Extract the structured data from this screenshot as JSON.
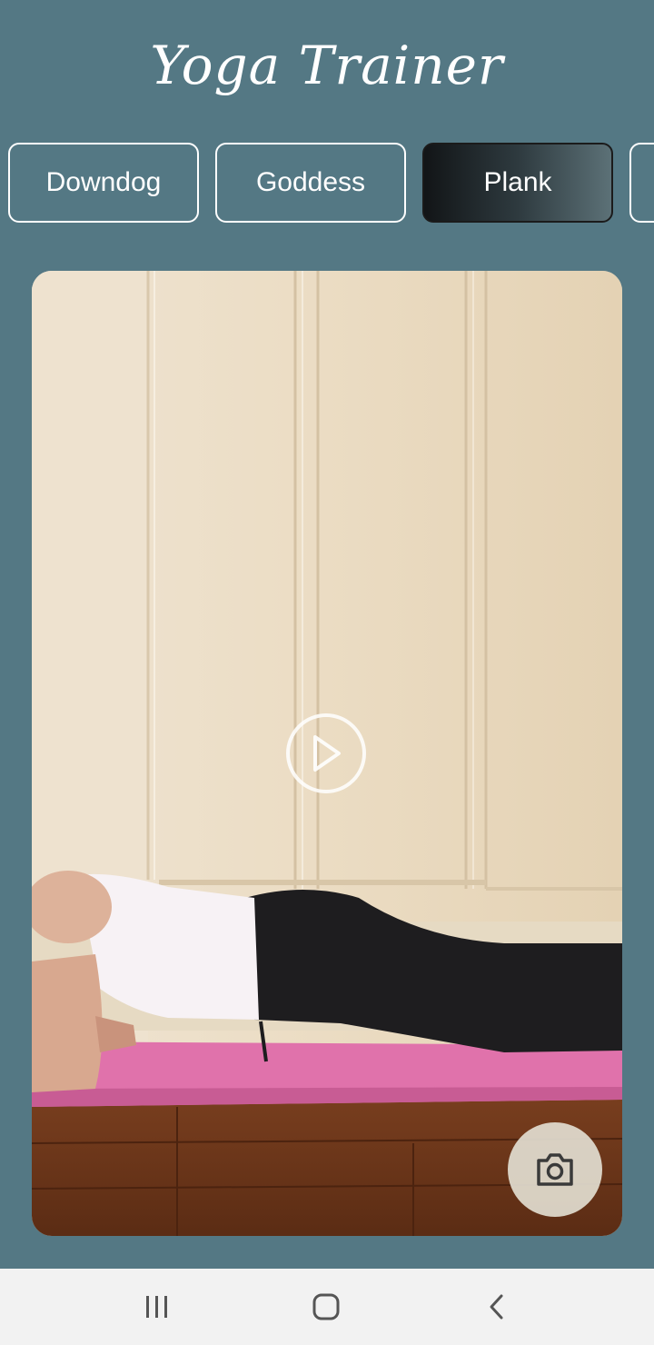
{
  "app": {
    "title": "Yoga Trainer"
  },
  "tabs": [
    {
      "label": "Downdog",
      "active": false
    },
    {
      "label": "Goddess",
      "active": false
    },
    {
      "label": "Plank",
      "active": true
    },
    {
      "label": "",
      "active": false
    }
  ],
  "video": {
    "play_icon": "play-icon",
    "camera_icon": "camera-icon"
  },
  "navbar": {
    "recents_icon": "recents-icon",
    "home_icon": "home-icon",
    "back_icon": "back-icon"
  },
  "colors": {
    "background": "#547884",
    "active_tab_start": "#121517",
    "active_tab_end": "#5c7177",
    "navbar": "#f2f2f2"
  }
}
